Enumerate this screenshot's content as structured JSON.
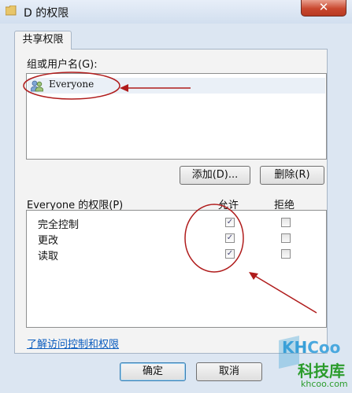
{
  "window": {
    "title": "D 的权限",
    "close_symbol": "✕"
  },
  "tab": {
    "label": "共享权限"
  },
  "users": {
    "label": "组或用户名(G):",
    "items": [
      {
        "name": "Everyone"
      }
    ],
    "add_button": "添加(D)...",
    "remove_button": "删除(R)"
  },
  "permissions": {
    "label": "Everyone 的权限(P)",
    "allow_header": "允许",
    "deny_header": "拒绝",
    "rows": [
      {
        "name": "完全控制",
        "allow": true,
        "deny": false
      },
      {
        "name": "更改",
        "allow": true,
        "deny": false
      },
      {
        "name": "读取",
        "allow": true,
        "deny": false
      }
    ]
  },
  "link": {
    "text": "了解访问控制和权限"
  },
  "footer": {
    "ok_button": "确定",
    "cancel_button": "取消"
  },
  "watermark": {
    "logo_prefix": "KH",
    "logo_suffix": "Coo",
    "chinese": "科技库",
    "domain": "khcoo.com"
  },
  "colors": {
    "annotation": "#b01c1c",
    "link": "#0b5dbf",
    "window_frame": "#dce6f2",
    "close_button": "#c9482f"
  }
}
